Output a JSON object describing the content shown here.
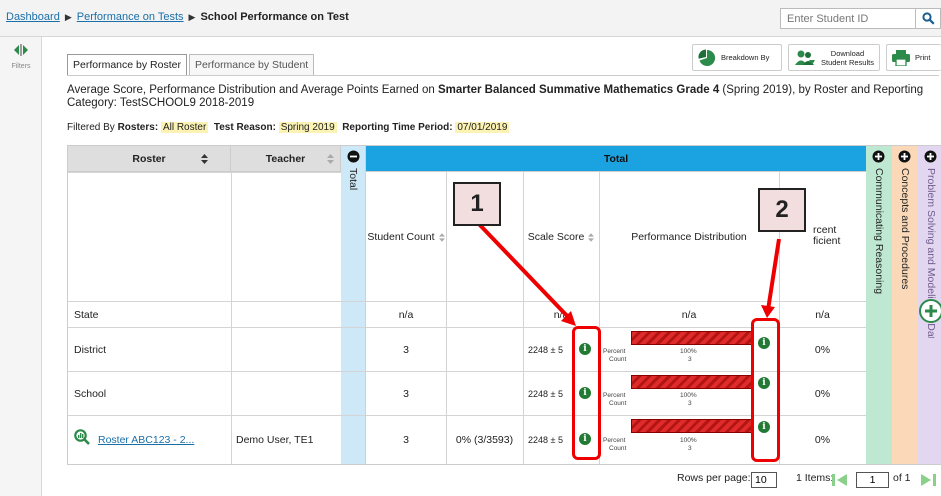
{
  "breadcrumb": {
    "dashboard": "Dashboard",
    "performance_on_tests": "Performance on Tests",
    "current": "School Performance on Test",
    "separator": "›"
  },
  "search": {
    "placeholder": "Enter Student ID"
  },
  "sidebar": {
    "filters_label": "Filters"
  },
  "tabs": [
    "Performance by Roster",
    "Performance by Student"
  ],
  "toolbar": {
    "breakdown_label": "Breakdown By",
    "download_label_1": "Download",
    "download_label_2": "Student Results",
    "print_label": "Print"
  },
  "description": {
    "prefix": "Average Score, Performance Distribution and Average Points Earned on ",
    "test_name": "Smarter Balanced Summative Mathematics Grade 4",
    "suffix": " (Spring 2019), by Roster and Reporting Category: TestSCHOOL9 2018-2019"
  },
  "filters": {
    "prefix": "Filtered By",
    "rosters_label": "Rosters:",
    "rosters_value": "All Roster",
    "reason_label": "Test Reason:",
    "reason_value": "Spring 2019",
    "period_label": "Reporting Time Period:",
    "period_value": "07/01/2019"
  },
  "table": {
    "headers": {
      "roster": "Roster",
      "teacher": "Teacher",
      "total_collapsed": "Total",
      "total_group": "Total",
      "student_count": "Student Count",
      "scale_score": "Scale Score",
      "performance_distribution": "Performance Distribution",
      "percent_proficient": "rcent\nficient",
      "communicating_reasoning": "Communicating Reasoning",
      "concepts_procedures": "Concepts and Procedures",
      "problem_solving": "Problem Solving and Modeling & Data Analysis"
    },
    "rows": [
      {
        "roster": "State",
        "teacher": "",
        "student_count": "n/a",
        "tested": "",
        "scale_score": "n/a",
        "distribution": "n/a",
        "proficient": "n/a"
      },
      {
        "roster": "District",
        "teacher": "",
        "student_count": "3",
        "tested": "",
        "scale_score": "2248 ± 5",
        "pct_label": "Percent",
        "count_label": "Count",
        "pct": "100%",
        "count": "3",
        "proficient": "0%"
      },
      {
        "roster": "School",
        "teacher": "",
        "student_count": "3",
        "tested": "",
        "scale_score": "2248 ± 5",
        "pct_label": "Percent",
        "count_label": "Count",
        "pct": "100%",
        "count": "3",
        "proficient": "0%"
      },
      {
        "roster": "Roster ABC123 - 2...",
        "teacher": "Demo User, TE1",
        "student_count": "3",
        "tested": "0% (3/3593)",
        "scale_score": "2248 ± 5",
        "pct_label": "Percent",
        "count_label": "Count",
        "pct": "100%",
        "count": "3",
        "proficient": "0%"
      }
    ]
  },
  "callouts": [
    "1",
    "2"
  ],
  "pagination": {
    "rows_per_page_label": "Rows per page:",
    "rows_per_page": "10",
    "items_label": "1 Items:",
    "page": "1",
    "of_label": "of 1"
  },
  "colors": {
    "total_header": "#1aa3e0",
    "total_collapsed": "#cde9f7",
    "communicating": "#bfe8d3",
    "concepts": "#fbd9b8",
    "problem_solving": "#e3d6f1",
    "bar": "#e02b2b",
    "info_icon": "#237a34",
    "callout": "#ee0000"
  }
}
